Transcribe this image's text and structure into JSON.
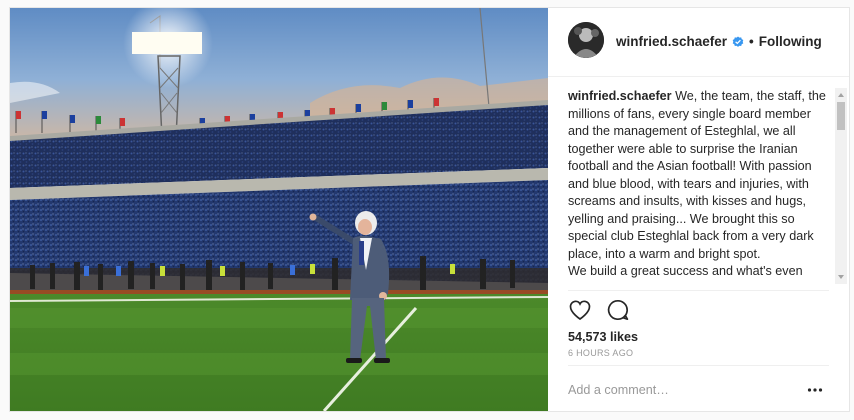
{
  "post": {
    "username": "winfried.schaefer",
    "follow_status": "Following",
    "separator": "•",
    "caption": {
      "user": "winfried.schaefer",
      "text": "We, the team, the staff, the millions of fans, every single board member and the management of Esteghlal, we all together were able to surprise the Iranian football and the Asian football! With passion and blue blood, with tears and injuries, with screams and insults, with kisses and hugs, yelling and praising... We brought this so special club Esteghlal back from a very dark place, into a warm and bright spot.",
      "text2": "We build a great success and what's even"
    },
    "likes": "54,573 likes",
    "time": "6 HOURS AGO",
    "comment_placeholder": "Add a comment…"
  },
  "icons": {
    "verified": "verified-badge-icon",
    "like": "heart-icon",
    "comment": "comment-bubble-icon",
    "more": "more-options-icon"
  },
  "colors": {
    "verified_blue": "#3897f0",
    "text": "#262626",
    "muted": "#999999",
    "border": "#efefef"
  }
}
